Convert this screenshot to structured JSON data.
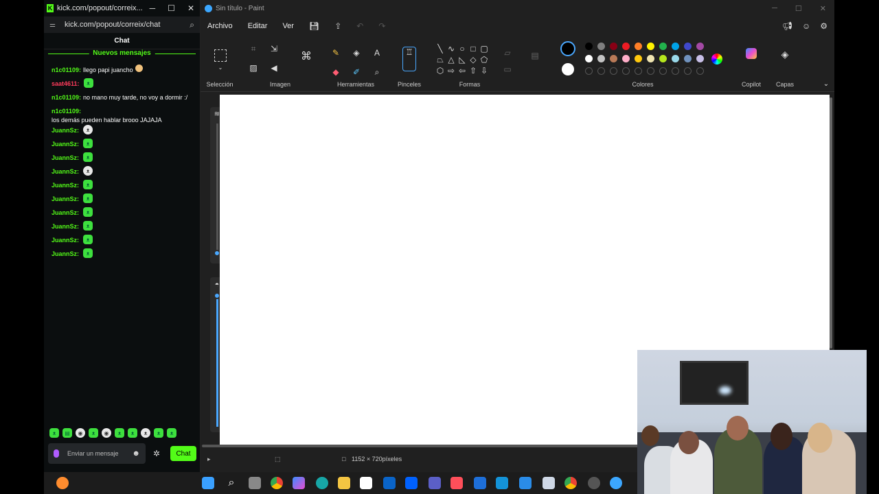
{
  "kick": {
    "tab_title": "kick.com/popout/correix...",
    "url": "kick.com/popout/correix/chat",
    "chat_header": "Chat",
    "new_messages_label": "Nuevos mensajes",
    "messages": [
      {
        "user": "n1c01109:",
        "text": "llego papi juancho",
        "color": "#53fc18"
      },
      {
        "user": "saat4611:",
        "text": "",
        "color": "#ff3b5c"
      },
      {
        "user": "n1c01109:",
        "text": "no mano muy tarde, no voy a dormir :/",
        "color": "#53fc18"
      },
      {
        "user": "n1c01109:",
        "text": "los demás pueden hablar brooo JAJAJA",
        "color": "#53fc18"
      },
      {
        "user": "JuannSz:",
        "text": "",
        "color": "#53fc18"
      },
      {
        "user": "JuannSz:",
        "text": "",
        "color": "#53fc18"
      },
      {
        "user": "JuannSz:",
        "text": "",
        "color": "#53fc18"
      },
      {
        "user": "JuannSz:",
        "text": "",
        "color": "#53fc18"
      },
      {
        "user": "JuannSz:",
        "text": "",
        "color": "#53fc18"
      },
      {
        "user": "JuannSz:",
        "text": "",
        "color": "#53fc18"
      },
      {
        "user": "JuannSz:",
        "text": "",
        "color": "#53fc18"
      },
      {
        "user": "JuannSz:",
        "text": "",
        "color": "#53fc18"
      },
      {
        "user": "JuannSz:",
        "text": "",
        "color": "#53fc18"
      },
      {
        "user": "JuannSz:",
        "text": "",
        "color": "#53fc18"
      }
    ],
    "input_placeholder": "Enviar un mensaje",
    "send_label": "Chat"
  },
  "paint": {
    "window_title": "Sin título - Paint",
    "menu": [
      "Archivo",
      "Editar",
      "Ver"
    ],
    "groups": {
      "selection": "Selección",
      "image": "Imagen",
      "tools": "Herramientas",
      "brushes": "Pinceles",
      "shapes": "Formas",
      "colors": "Colores",
      "copilot": "Copilot",
      "layers": "Capas"
    },
    "canvas_size": "1152 × 720píxeles",
    "palette_row1": [
      "#000000",
      "#7f7f7f",
      "#880015",
      "#ed1c24",
      "#ff7f27",
      "#fff200",
      "#22b14c",
      "#00a2e8",
      "#3f48cc",
      "#a349a4"
    ],
    "palette_row2": [
      "#ffffff",
      "#c3c3c3",
      "#b97a57",
      "#ffaec9",
      "#ffc90e",
      "#efe4b0",
      "#b5e61d",
      "#99d9ea",
      "#7092be",
      "#c8bfe7"
    ]
  }
}
